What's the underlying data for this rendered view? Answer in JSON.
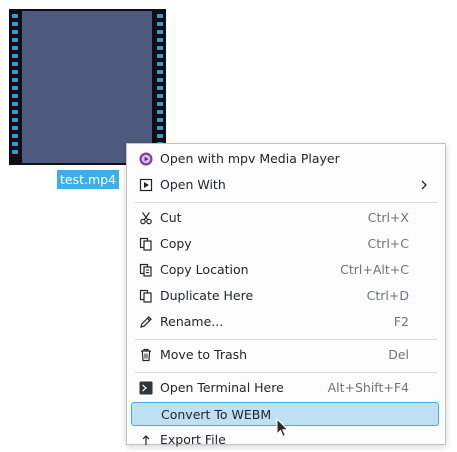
{
  "file": {
    "name": "test.mp4",
    "thumbnail_color": "#4f5a80",
    "selected_color": "#3daee9"
  },
  "menu": {
    "items": [
      {
        "label": "Open with mpv Media Player",
        "shortcut": "",
        "icon": "mpv-icon"
      },
      {
        "label": "Open With",
        "shortcut": "",
        "icon": "open-with-icon",
        "submenu": true
      },
      {
        "label": "Cut",
        "shortcut": "Ctrl+X",
        "icon": "scissors-icon"
      },
      {
        "label": "Copy",
        "shortcut": "Ctrl+C",
        "icon": "copy-icon"
      },
      {
        "label": "Copy Location",
        "shortcut": "Ctrl+Alt+C",
        "icon": "copy-location-icon"
      },
      {
        "label": "Duplicate Here",
        "shortcut": "Ctrl+D",
        "icon": "duplicate-icon"
      },
      {
        "label": "Rename...",
        "shortcut": "F2",
        "icon": "pencil-icon"
      },
      {
        "label": "Move to Trash",
        "shortcut": "Del",
        "icon": "trash-icon"
      },
      {
        "label": "Open Terminal Here",
        "shortcut": "Alt+Shift+F4",
        "icon": "terminal-icon"
      },
      {
        "label": "Convert To WEBM",
        "shortcut": "",
        "icon": "",
        "highlighted": true
      },
      {
        "label": "Export File",
        "shortcut": "",
        "icon": "export-icon"
      }
    ],
    "highlight_color": "#bfdff3"
  }
}
